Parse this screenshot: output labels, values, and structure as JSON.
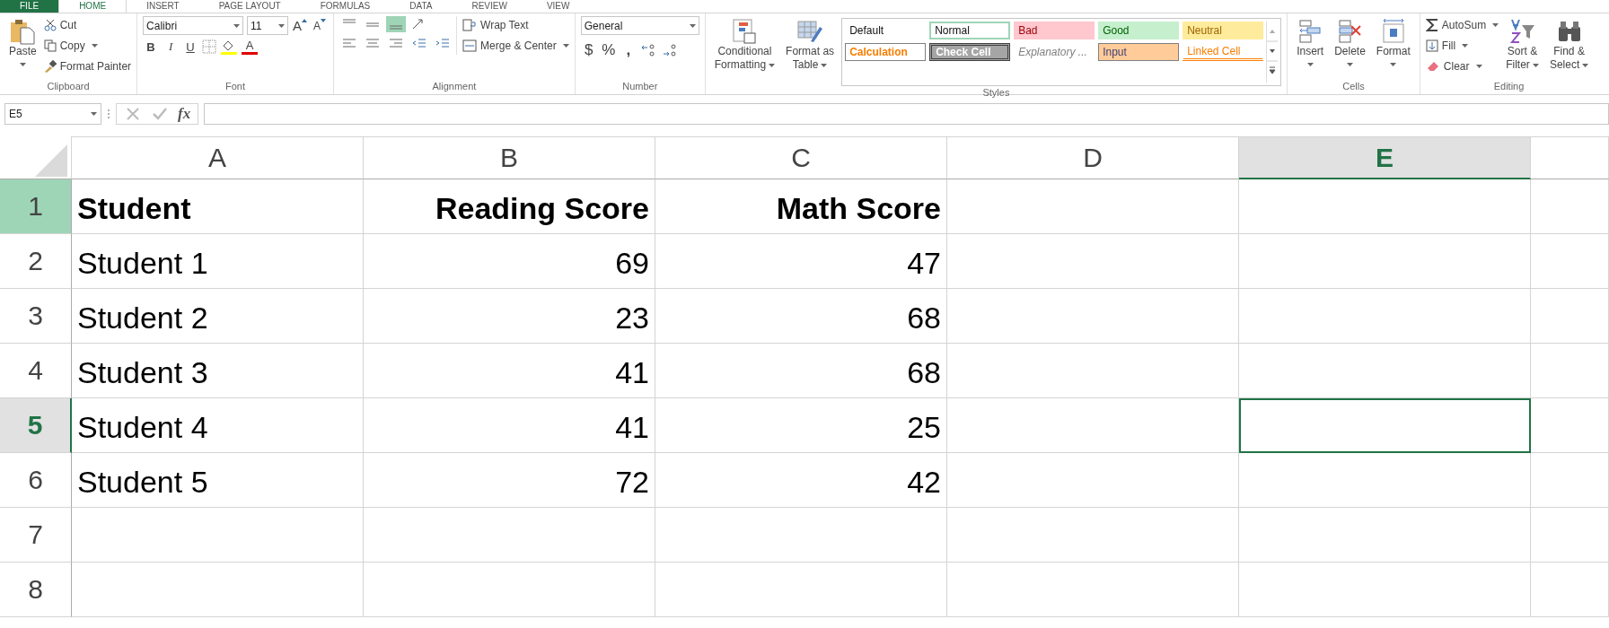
{
  "tabs": [
    {
      "label": "FILE",
      "kind": "file",
      "selected": false
    },
    {
      "label": "HOME",
      "kind": "tab",
      "selected": true
    },
    {
      "label": "INSERT",
      "kind": "tab",
      "selected": false
    },
    {
      "label": "PAGE LAYOUT",
      "kind": "tab",
      "selected": false
    },
    {
      "label": "FORMULAS",
      "kind": "tab",
      "selected": false
    },
    {
      "label": "DATA",
      "kind": "tab",
      "selected": false
    },
    {
      "label": "REVIEW",
      "kind": "tab",
      "selected": false
    },
    {
      "label": "VIEW",
      "kind": "tab",
      "selected": false
    }
  ],
  "clipboard": {
    "label": "Clipboard",
    "paste": "Paste",
    "cut": "Cut",
    "copy": "Copy",
    "format_painter": "Format Painter"
  },
  "font": {
    "label": "Font",
    "font_name": "Calibri",
    "font_size": "11",
    "grow": "A",
    "shrink": "A",
    "bold": "B",
    "italic": "I",
    "underline": "U",
    "font_color": "A"
  },
  "alignment": {
    "label": "Alignment",
    "bottom_align_selected": true,
    "wrap_text": "Wrap Text",
    "merge_center": "Merge & Center"
  },
  "number": {
    "label": "Number",
    "format": "General",
    "currency": "$",
    "percent": "%",
    "comma": ","
  },
  "styles": {
    "label": "Styles",
    "conditional_formatting": [
      "Conditional",
      "Formatting"
    ],
    "format_as_table": [
      "Format as",
      "Table"
    ],
    "cell_styles": [
      "Default",
      "Normal",
      "Bad",
      "Good",
      "Neutral",
      "Calculation",
      "Check Cell",
      "Explanatory ...",
      "Input",
      "Linked Cell"
    ]
  },
  "cells": {
    "label": "Cells",
    "insert": "Insert",
    "delete": "Delete",
    "format": "Format"
  },
  "editing": {
    "label": "Editing",
    "autosum": "AutoSum",
    "fill": "Fill",
    "clear": "Clear",
    "sort_filter": [
      "Sort &",
      "Filter"
    ],
    "find_select": [
      "Find &",
      "Select"
    ]
  },
  "formula_bar": {
    "name_box": "E5",
    "fx": "fx"
  },
  "sheet": {
    "columns": [
      {
        "label": "A",
        "selected": false
      },
      {
        "label": "B",
        "selected": false
      },
      {
        "label": "C",
        "selected": false
      },
      {
        "label": "D",
        "selected": false
      },
      {
        "label": "E",
        "selected": true
      }
    ],
    "rows": [
      {
        "header": "1",
        "kind": "header",
        "selected": false,
        "hovered": true,
        "cells": [
          "Student",
          "Reading Score",
          "Math Score"
        ]
      },
      {
        "header": "2",
        "kind": "data",
        "selected": false,
        "hovered": false,
        "cells": [
          "Student 1",
          "69",
          "47"
        ]
      },
      {
        "header": "3",
        "kind": "data",
        "selected": false,
        "hovered": false,
        "cells": [
          "Student 2",
          "23",
          "68"
        ]
      },
      {
        "header": "4",
        "kind": "data",
        "selected": false,
        "hovered": false,
        "cells": [
          "Student 3",
          "41",
          "68"
        ]
      },
      {
        "header": "5",
        "kind": "data",
        "selected": true,
        "hovered": false,
        "cells": [
          "Student 4",
          "41",
          "25"
        ]
      },
      {
        "header": "6",
        "kind": "data",
        "selected": false,
        "hovered": false,
        "cells": [
          "Student 5",
          "72",
          "42"
        ]
      },
      {
        "header": "7",
        "kind": "data",
        "selected": false,
        "hovered": false
      },
      {
        "header": "8",
        "kind": "data",
        "selected": false,
        "hovered": false
      }
    ]
  }
}
